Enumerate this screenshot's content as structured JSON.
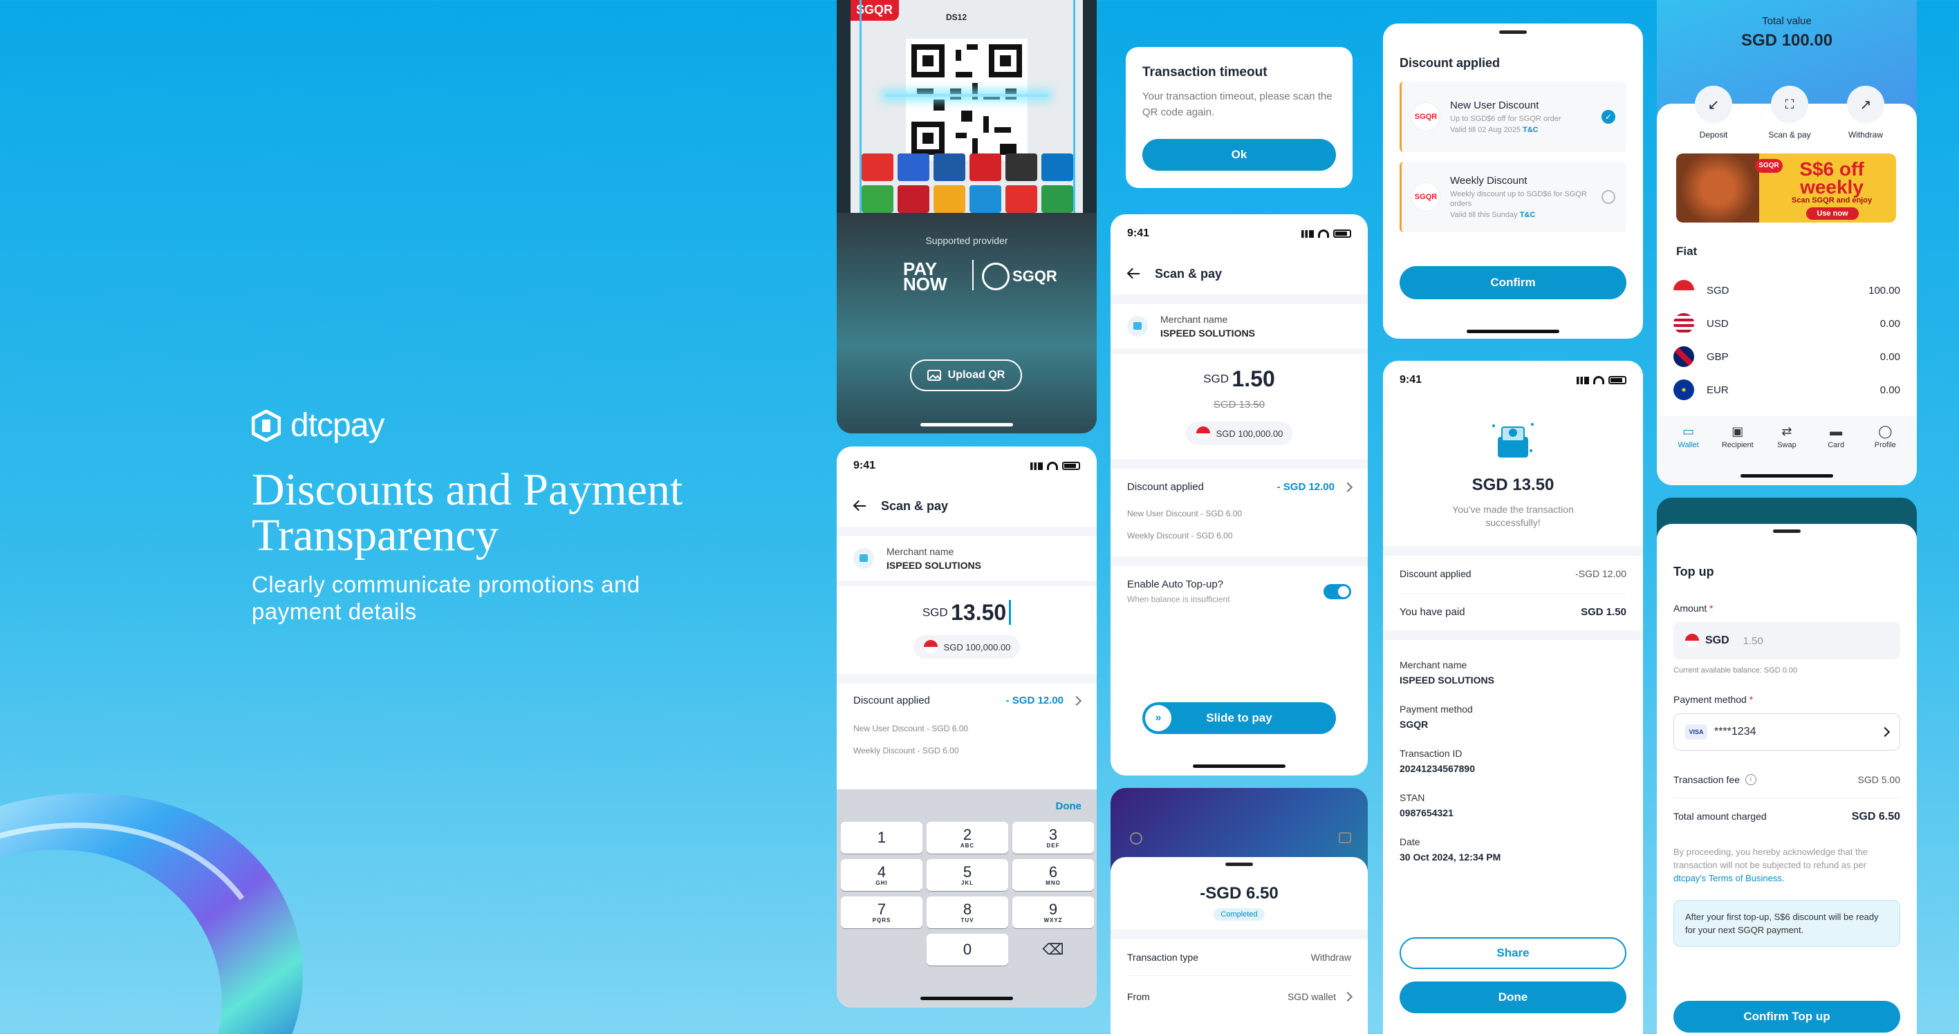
{
  "hero": {
    "brand": "dtcpay",
    "title": "Discounts and Payment Transparency",
    "subtitle": "Clearly communicate promotions and payment details"
  },
  "scanner": {
    "kiosk_code": "DS12",
    "sgqr_label": "SGQR",
    "supported_provider": "Supported provider",
    "paynow": "PAY NOW",
    "sgqr": "SGQR",
    "upload_qr": "Upload QR"
  },
  "scan_keypad": {
    "time": "9:41",
    "title": "Scan & pay",
    "merchant_label": "Merchant name",
    "merchant_value": "ISPEED SOLUTIONS",
    "currency": "SGD",
    "amount": "13.50",
    "balance": "SGD 100,000.00",
    "discount_label": "Discount applied",
    "discount_value": "- SGD 12.00",
    "discount_line1": "New User Discount - SGD 6.00",
    "discount_line2": "Weekly Discount - SGD 6.00",
    "done": "Done",
    "keys": [
      {
        "n": "1",
        "l": ""
      },
      {
        "n": "2",
        "l": "ABC"
      },
      {
        "n": "3",
        "l": "DEF"
      },
      {
        "n": "4",
        "l": "GHI"
      },
      {
        "n": "5",
        "l": "JKL"
      },
      {
        "n": "6",
        "l": "MNO"
      },
      {
        "n": "7",
        "l": "PQRS"
      },
      {
        "n": "8",
        "l": "TUV"
      },
      {
        "n": "9",
        "l": "WXYZ"
      },
      {
        "n": "",
        "l": ""
      },
      {
        "n": "0",
        "l": ""
      },
      {
        "n": "⌫",
        "l": ""
      }
    ]
  },
  "timeout": {
    "title": "Transaction timeout",
    "message": "Your transaction timeout, please scan the QR code again.",
    "ok": "Ok"
  },
  "scan_slide": {
    "time": "9:41",
    "title": "Scan & pay",
    "merchant_label": "Merchant name",
    "merchant_value": "ISPEED SOLUTIONS",
    "currency": "SGD",
    "amount": "1.50",
    "original": "SGD 13.50",
    "balance": "SGD 100,000.00",
    "discount_label": "Discount applied",
    "discount_value": "- SGD 12.00",
    "discount_line1": "New User Discount - SGD 6.00",
    "discount_line2": "Weekly Discount - SGD 6.00",
    "auto_topup_label": "Enable Auto Top-up?",
    "auto_topup_sub": "When balance is insufficient",
    "slide": "Slide to pay"
  },
  "completed_sheet": {
    "amount": "-SGD 6.50",
    "status": "Completed",
    "type_label": "Transaction type",
    "type_value": "Withdraw",
    "from_label": "From",
    "from_value": "SGD wallet"
  },
  "discount_sheet": {
    "title": "Discount applied",
    "items": [
      {
        "name": "New User Discount",
        "desc": "Up to SGD$6 off for SGQR order",
        "valid": "Valid till 02 Aug 2025",
        "tc": "T&C",
        "selected": true
      },
      {
        "name": "Weekly Discount",
        "desc": "Weekly discount up to SGD$6 for SGQR orders",
        "valid": "Valid till this Sunday",
        "tc": "T&C",
        "selected": false
      }
    ],
    "confirm": "Confirm"
  },
  "receipt": {
    "time": "9:41",
    "amount": "SGD 13.50",
    "message": "You've made the transaction successfully!",
    "discount_label": "Discount applied",
    "discount_value": "-SGD 12.00",
    "paid_label": "You have paid",
    "paid_value": "SGD 1.50",
    "fields": [
      {
        "label": "Merchant name",
        "value": "ISPEED SOLUTIONS"
      },
      {
        "label": "Payment method",
        "value": "SGQR"
      },
      {
        "label": "Transaction ID",
        "value": "20241234567890"
      },
      {
        "label": "STAN",
        "value": "0987654321"
      },
      {
        "label": "Date",
        "value": "30 Oct 2024, 12:34 PM"
      }
    ],
    "share": "Share",
    "done": "Done"
  },
  "wallet": {
    "total_label": "Total value",
    "total_value": "SGD 100.00",
    "actions": [
      "Deposit",
      "Scan & pay",
      "Withdraw"
    ],
    "promo_title": "S$6 off weekly",
    "promo_sub": "Scan SGQR and enjoy",
    "promo_cta": "Use now",
    "fiat_label": "Fiat",
    "currencies": [
      {
        "code": "SGD",
        "value": "100.00"
      },
      {
        "code": "USD",
        "value": "0.00"
      },
      {
        "code": "GBP",
        "value": "0.00"
      },
      {
        "code": "EUR",
        "value": "0.00"
      }
    ],
    "tabs": [
      "Wallet",
      "Recipient",
      "Swap",
      "Card",
      "Profile"
    ]
  },
  "topup": {
    "title": "Top up",
    "amount_label": "Amount",
    "currency": "SGD",
    "amount_placeholder": "1.50",
    "balance_note": "Current available balance: SGD 0.00",
    "method_label": "Payment method",
    "card_brand": "VISA",
    "card_masked": "****1234",
    "fee_label": "Transaction fee",
    "fee_value": "SGD 5.00",
    "total_label": "Total amount charged",
    "total_value": "SGD 6.50",
    "disclaimer": "By proceeding, you hereby acknowledge that the transaction will not be subjected to refund as per",
    "terms_link": "dtcpay's Terms of Business.",
    "info": "After your first top-up, S$6 discount will be ready for your next SGQR payment.",
    "confirm": "Confirm Top up"
  },
  "colors": {
    "primary": "#0a96cf",
    "background": "#1ab0ea",
    "accent_red": "#e21d2b"
  }
}
